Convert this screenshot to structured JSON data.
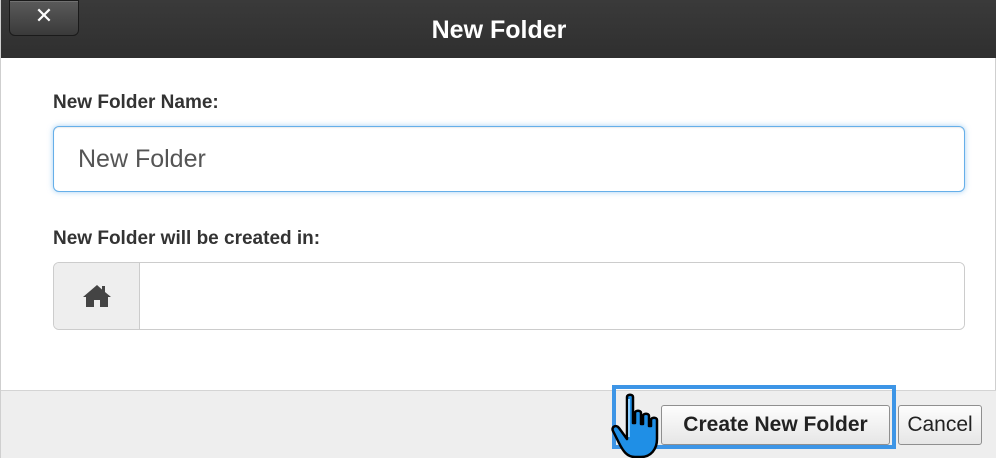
{
  "dialog": {
    "title": "New Folder",
    "close_label": "✕"
  },
  "form": {
    "name_label": "New Folder Name:",
    "name_value": "New Folder",
    "location_label": "New Folder will be created in:",
    "location_value": ""
  },
  "footer": {
    "create_label": "Create New Folder",
    "cancel_label": "Cancel"
  },
  "icons": {
    "close": "close-icon",
    "home": "home-icon",
    "cursor": "hand-pointer-cursor-icon"
  },
  "colors": {
    "titlebar": "#333333",
    "focus_blue": "#3d95e6",
    "input_focus": "#66afe9",
    "footer_bg": "#eeeeee"
  }
}
